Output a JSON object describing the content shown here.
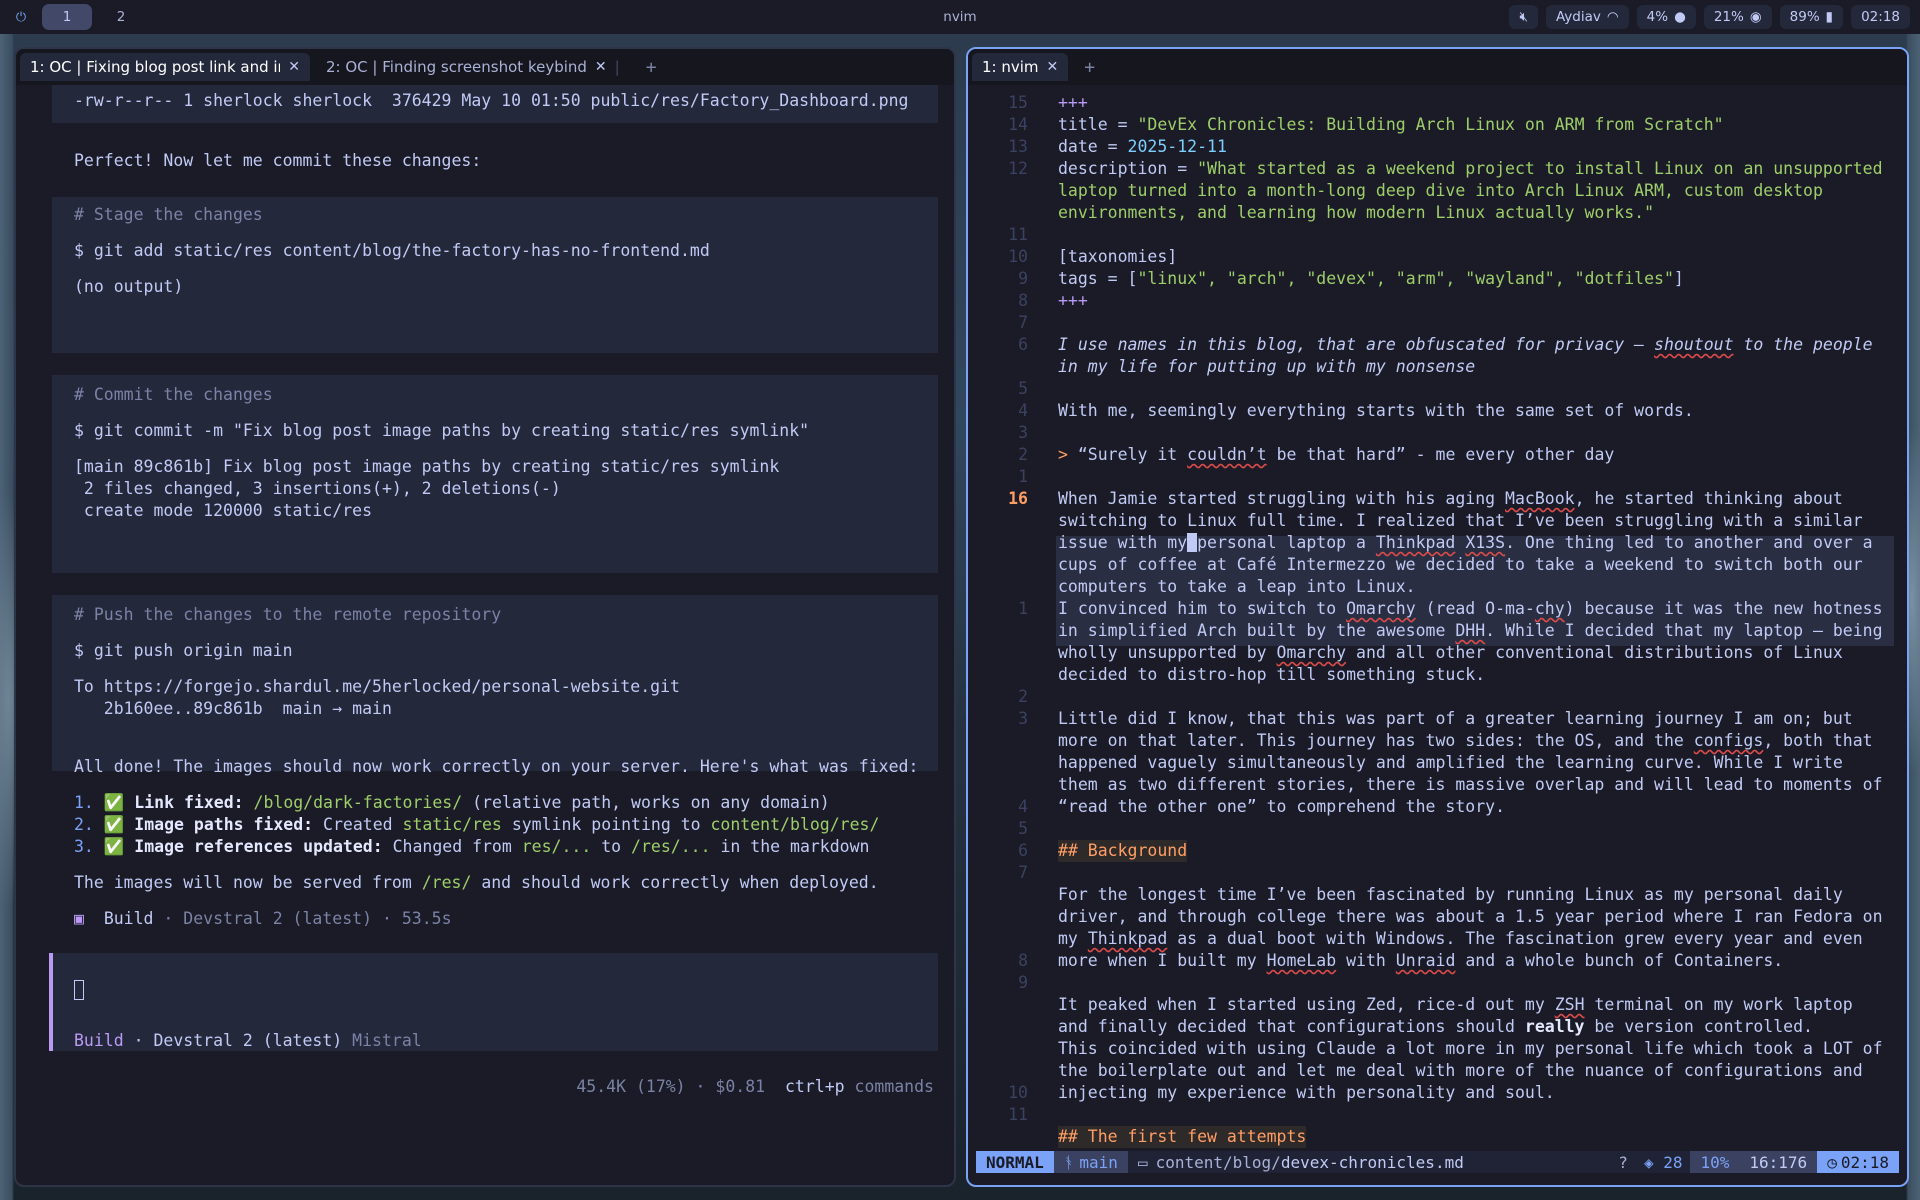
{
  "topbar": {
    "workspaces": [
      "1",
      "2"
    ],
    "title": "nvim",
    "network": "Aydiav",
    "cpu": "4%",
    "memory": "21%",
    "battery": "89%",
    "time": "02:18"
  },
  "left": {
    "tabs": [
      "1: OC | Fixing blog post link and imag",
      "2: OC | Finding screenshot keybind"
    ],
    "ls_line": "-rw-r--r-- 1 sherlock sherlock  376429 May 10 01:50 public/res/Factory_Dashboard.png",
    "perfect": "Perfect! Now let me commit these changes:",
    "stage_comment": "# Stage the changes",
    "stage_cmd": "$ git add static/res content/blog/the-factory-has-no-frontend.md",
    "stage_out": "(no output)",
    "commit_comment": "# Commit the changes",
    "commit_cmd": "$ git commit -m \"Fix blog post image paths by creating static/res symlink\"",
    "commit_out1": "[main 89c861b] Fix blog post image paths by creating static/res symlink",
    "commit_out2": " 2 files changed, 3 insertions(+), 2 deletions(-)",
    "commit_out3": " create mode 120000 static/res",
    "push_comment": "# Push the changes to the remote repository",
    "push_cmd": "$ git push origin main",
    "push_out1": "To https://forgejo.shardul.me/5herlocked/personal-website.git",
    "push_out2": "   2b160ee..89c861b  main → main",
    "done": "All done! The images should now work correctly on your server. Here's what was fixed:",
    "item1_num": "1.",
    "item1_check": "✅",
    "item1_label": "Link fixed:",
    "item1_path": "/blog/dark-factories/",
    "item1_rest": "(relative path, works on any domain)",
    "item2_num": "2.",
    "item2_check": "✅",
    "item2_label": "Image paths fixed:",
    "item2_a": "Created",
    "item2_b": "static/res",
    "item2_c": "symlink pointing to",
    "item2_d": "content/blog/res/",
    "item3_num": "3.",
    "item3_check": "✅",
    "item3_label": "Image references updated:",
    "item3_a": "Changed from",
    "item3_b": "res/...",
    "item3_c": "to",
    "item3_d": "/res/...",
    "item3_e": "in the markdown",
    "served_a": "The images will now be served from",
    "served_b": "/res/",
    "served_c": "and should work correctly when deployed.",
    "build_icon": "▣",
    "build_label": "Build",
    "build_meta": "· Devstral 2 (latest) · 53.5s",
    "input_build": "Build",
    "input_model": "· Devstral 2 (latest)",
    "input_provider": "Mistral",
    "footer_usage": "45.4K (17%) · $0.81",
    "footer_cmd": "ctrl+p",
    "footer_cmd_label": "commands"
  },
  "right": {
    "tabs": [
      "1: nvim"
    ],
    "gutter": [
      "15",
      "14",
      "13",
      "12",
      "",
      "",
      "11",
      "10",
      "9",
      "8",
      "7",
      "6",
      "",
      "5",
      "4",
      "3",
      "2",
      "1",
      "16",
      "",
      "",
      "",
      "",
      "1",
      "",
      "",
      "",
      "2",
      "3",
      "",
      "",
      "",
      "4",
      "5",
      "6",
      "7",
      "",
      "",
      "",
      "8",
      "9",
      "",
      "",
      "",
      "",
      "10",
      "11"
    ],
    "l_fm": "+++",
    "l_title_key": "title = ",
    "l_title_val": "\"DevEx Chronicles: Building Arch Linux on ARM from Scratch\"",
    "l_date_key": "date = ",
    "l_date_val": "2025-12-11",
    "l_desc_key": "description = ",
    "l_desc_1": "\"What started as a weekend project to install Linux on an unsupported",
    "l_desc_2": "laptop turned into a month-long deep dive into Arch Linux ARM, custom desktop",
    "l_desc_3": "environments, and learning how modern Linux actually works.\"",
    "l_tax": "[taxonomies]",
    "l_tags_key": "tags = [",
    "l_tags_val": "\"linux\", \"arch\", \"devex\", \"arm\", \"wayland\", \"dotfiles\"",
    "l_tags_end": "]",
    "l_fm2": "+++",
    "l_ital1_a": "I use names in this blog, that are obfuscated for privacy — ",
    "l_ital1_b": "shoutout",
    "l_ital1_c": " to the people",
    "l_ital2": "in my life for putting up with my nonsense",
    "l_with": "With me, seemingly everything starts with the same set of words.",
    "l_quote_mark": "> ",
    "l_quote_a": "“Surely it ",
    "l_quote_b": "couldn’t",
    "l_quote_c": " be that hard” - me every other day",
    "p1_1a": "When Jamie started struggling with his aging ",
    "p1_1b": "MacBook",
    "p1_1c": ", he started thinking about",
    "p1_2": "switching to Linux full time. I realized that I’ve been struggling with a similar",
    "p1_3a": "issue with my",
    "p1_3cur": " ",
    "p1_3b": "personal laptop a ",
    "p1_3c": "Thinkpad",
    "p1_3d": " ",
    "p1_3e": "X13S",
    "p1_3f": ". One thing led to another and over a",
    "p1_4": "cups of coffee at Café Intermezzo we decided to take a weekend to switch both our",
    "p1_5": "computers to take a leap into Linux.",
    "p2_1a": "I convinced him to switch to ",
    "p2_1b": "Omarchy",
    "p2_1c": " (read O-ma-",
    "p2_1d": "chy",
    "p2_1e": ") because it was the new hotness",
    "p2_2a": "in simplified Arch built by the awesome ",
    "p2_2b": "DHH",
    "p2_2c": ". While I decided that my laptop — being",
    "p2_3a": "wholly unsupported by ",
    "p2_3b": "Omarchy",
    "p2_3c": " and all other conventional distributions of Linux",
    "p2_4": "decided to distro-hop till something stuck.",
    "p3_1": "Little did I know, that this was part of a greater learning journey I am on; but",
    "p3_2a": "more on that later. This journey has two sides: the OS, and the ",
    "p3_2b": "configs",
    "p3_2c": ", both that",
    "p3_3": "happened vaguely simultaneously and amplified the learning curve. While I write",
    "p3_4": "them as two different stories, there is massive overlap and will lead to moments of",
    "p3_5": "“read the other one” to comprehend the story.",
    "h_bg": "## Background",
    "p4_1": "For the longest time I’ve been fascinated by running Linux as my personal daily",
    "p4_2": "driver, and through college there was about a 1.5 year period where I ran Fedora on",
    "p4_3a": "my ",
    "p4_3b": "Thinkpad",
    "p4_3c": " as a dual boot with Windows. The fascination grew every year and even",
    "p4_4a": "more when I built my ",
    "p4_4b": "HomeLab",
    "p4_4c": " with ",
    "p4_4d": "Unraid",
    "p4_4e": " and a whole bunch of Containers.",
    "p5_1a": "It peaked when I started using Zed, rice-d out my ",
    "p5_1b": "ZSH",
    "p5_1c": " terminal on my work laptop",
    "p5_2a": "and finally decided that configurations should ",
    "p5_2b": "really",
    "p5_2c": " be version controlled.",
    "p5_3": "This coincided with using Claude a lot more in my personal life which took a LOT of",
    "p5_4": "the boilerplate out and let me deal with more of the nuance of configurations and",
    "p5_5": "injecting my experience with personality and soul.",
    "h_first": "## The first few attempts",
    "status": {
      "mode": "NORMAL",
      "branch": "main",
      "path_dir": "content/blog/",
      "path_file": "devex-chronicles.md",
      "q": "?",
      "lsp": "28",
      "pct": "10%",
      "pos": "16:176",
      "time": "02:18"
    }
  }
}
